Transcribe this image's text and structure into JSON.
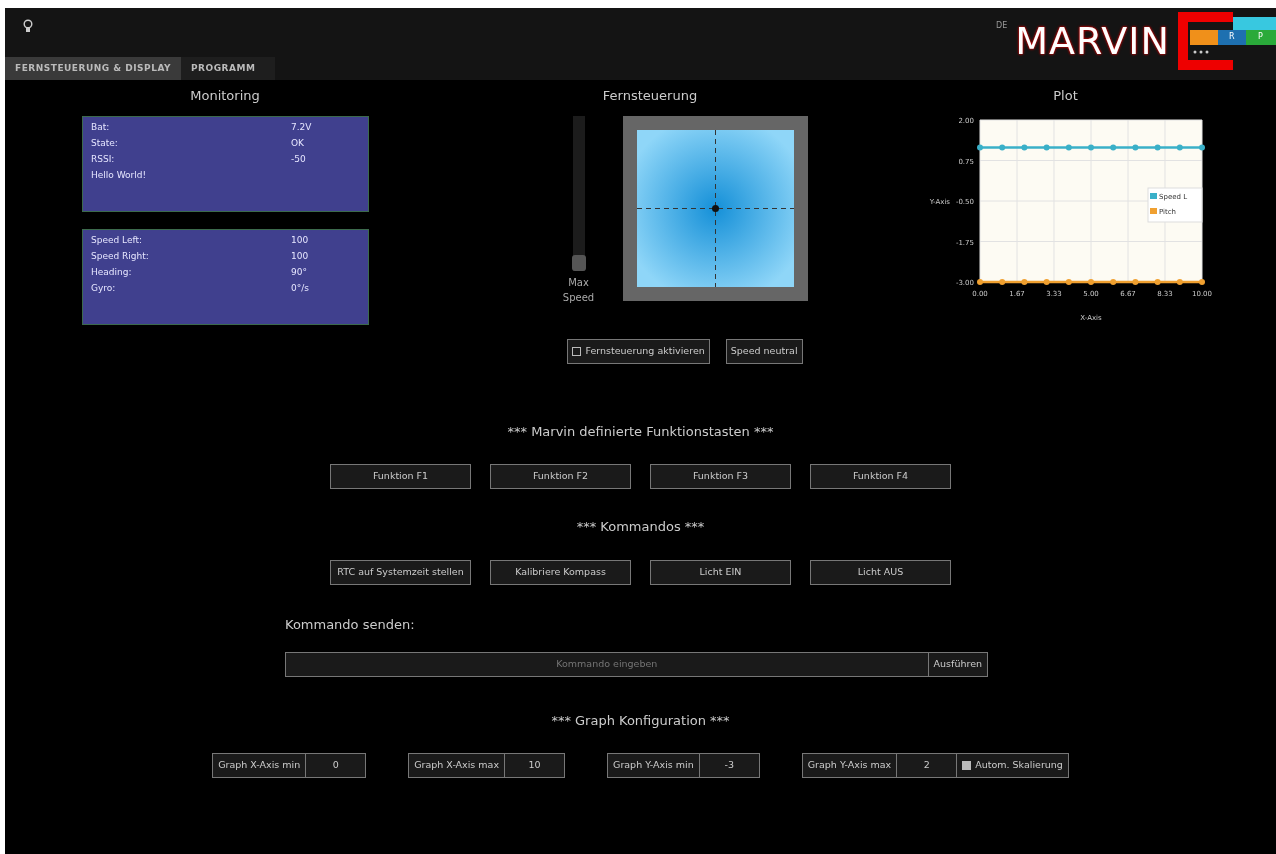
{
  "header": {
    "language": "DE",
    "logo_text": "MARVIN",
    "logo_blocks": [
      "R",
      "P"
    ]
  },
  "tabs": [
    {
      "label": "FERNSTEUERUNG & DISPLAY",
      "selected": true
    },
    {
      "label": "PROGRAMM",
      "selected": false
    }
  ],
  "monitoring": {
    "title": "Monitoring",
    "panels": [
      {
        "rows": [
          {
            "label": "Bat:",
            "value": "7.2V"
          },
          {
            "label": "State:",
            "value": "OK"
          },
          {
            "label": "RSSI:",
            "value": "-50"
          },
          {
            "label": "Hello World!"
          }
        ]
      },
      {
        "rows": [
          {
            "label": "Speed Left:",
            "value": "100"
          },
          {
            "label": "Speed Right:",
            "value": "100"
          },
          {
            "label": "Heading:",
            "value": "90°"
          },
          {
            "label": "Gyro:",
            "value": "0°/s"
          }
        ]
      }
    ]
  },
  "remote": {
    "title": "Fernsteuerung",
    "max_speed": {
      "label": "Max Speed",
      "level": 0
    },
    "activate": {
      "label": "Fernsteuerung aktivieren",
      "checked": false
    },
    "neutral_button": "Speed neutral"
  },
  "plot": {
    "title": "Plot",
    "chart_data": {
      "type": "line",
      "xlabel": "X-Axis",
      "ylabel": "Y-Axis",
      "x": [
        0,
        1,
        2,
        3,
        4,
        5,
        6,
        7,
        8,
        9,
        10
      ],
      "series": [
        {
          "name": "Speed L",
          "color": "#3ab0c8",
          "marker": "circle",
          "values": [
            1.15,
            1.15,
            1.15,
            1.15,
            1.15,
            1.15,
            1.15,
            1.15,
            1.15,
            1.15,
            1.15
          ]
        },
        {
          "name": "Pitch",
          "color": "#f0a030",
          "marker": "circle",
          "values": [
            -3,
            -3,
            -3,
            -3,
            -3,
            -3,
            -3,
            -3,
            -3,
            -3,
            -3
          ]
        }
      ],
      "xlim": [
        0,
        10
      ],
      "ylim": [
        -3,
        2
      ],
      "grid": true,
      "legend": true,
      "xticks": [
        {
          "value": 0,
          "label": "0.00"
        },
        {
          "value": 1.667,
          "label": "1.67"
        },
        {
          "value": 3.333,
          "label": "3.33"
        },
        {
          "value": 5,
          "label": "5.00"
        },
        {
          "value": 6.667,
          "label": "6.67"
        },
        {
          "value": 8.333,
          "label": "8.33"
        },
        {
          "value": 10,
          "label": "10.00"
        }
      ],
      "yticks": [
        {
          "value": 2,
          "label": "2.00"
        },
        {
          "value": 0.75,
          "label": "0.75"
        },
        {
          "value": -0.5,
          "label": "-0.50"
        },
        {
          "value": -1.75,
          "label": "-1.75"
        },
        {
          "value": -3,
          "label": "-3.00"
        }
      ]
    }
  },
  "function_keys": {
    "title": "*** Marvin definierte Funktionstasten ***",
    "buttons": [
      "Funktion F1",
      "Funktion F2",
      "Funktion F3",
      "Funktion F4"
    ]
  },
  "commands": {
    "title": "*** Kommandos ***",
    "buttons": [
      "RTC auf Systemzeit stellen",
      "Kalibriere Kompass",
      "Licht EIN",
      "Licht AUS"
    ]
  },
  "send_command": {
    "label": "Kommando senden:",
    "placeholder": "Kommando eingeben",
    "button": "Ausführen"
  },
  "graph_config": {
    "title": "*** Graph Konfiguration ***",
    "fields": [
      {
        "label": "Graph X-Axis min",
        "value": "0"
      },
      {
        "label": "Graph X-Axis max",
        "value": "10"
      },
      {
        "label": "Graph Y-Axis min",
        "value": "-3"
      },
      {
        "label": "Graph Y-Axis max",
        "value": "2"
      }
    ],
    "auto_scale": {
      "label": "Autom. Skalierung",
      "checked": true
    }
  }
}
